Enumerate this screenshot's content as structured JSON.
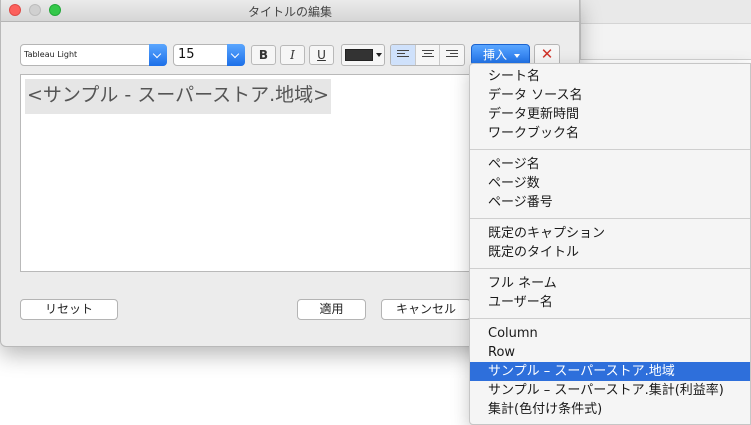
{
  "window": {
    "title": "タイトルの編集"
  },
  "toolbar": {
    "font_family": "Tableau Light",
    "font_size": "15",
    "bold_label": "B",
    "italic_label": "I",
    "underline_label": "U",
    "text_color": "#333333",
    "insert_label": "挿入",
    "delete_label": "✕"
  },
  "editor": {
    "content": "<サンプル - スーパーストア.地域>"
  },
  "buttons": {
    "reset": "リセット",
    "apply": "適用",
    "cancel": "キャンセル"
  },
  "insert_menu": {
    "groups": [
      [
        "シート名",
        "データ ソース名",
        "データ更新時間",
        "ワークブック名"
      ],
      [
        "ページ名",
        "ページ数",
        "ページ番号"
      ],
      [
        "既定のキャプション",
        "既定のタイトル"
      ],
      [
        "フル ネーム",
        "ユーザー名"
      ],
      [
        "Column",
        "Row",
        "サンプル – スーパーストア.地域",
        "サンプル – スーパーストア.集計(利益率)",
        "集計(色付け条件式)"
      ]
    ],
    "selected": "サンプル – スーパーストア.地域"
  },
  "colors": {
    "accent": "#2e6fdb",
    "close_red": "#d0342a"
  }
}
